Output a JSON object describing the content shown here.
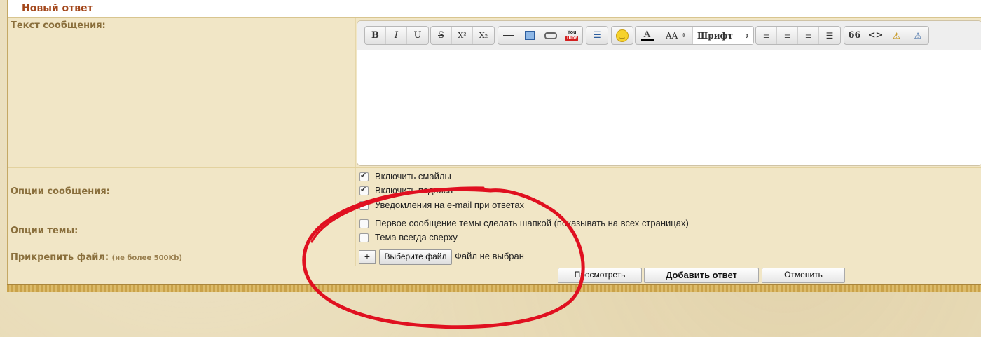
{
  "header": {
    "title": "Новый ответ"
  },
  "labels": {
    "message_text": "Текст сообщения:",
    "message_options": "Опции сообщения:",
    "topic_options": "Опции темы:",
    "attach_file": "Прикрепить файл:",
    "attach_limit": "(не более 500Kb)"
  },
  "toolbar": {
    "bold": "B",
    "italic": "I",
    "underline": "U",
    "strike": "S",
    "superscript": "X²",
    "subscript": "X₂",
    "youtube_top": "You",
    "youtube_bottom": "Tube",
    "font_color": "A",
    "font_size": "AA",
    "font_family": "Шрифт",
    "quote": "66",
    "code": "<>"
  },
  "message_options": [
    {
      "label": "Включить смайлы",
      "checked": true
    },
    {
      "label": "Включить подпись",
      "checked": true
    },
    {
      "label": "Уведомления на e-mail при ответах",
      "checked": false
    }
  ],
  "topic_options": [
    {
      "label": "Первое сообщение темы сделать шапкой (показывать на всех страницах)",
      "checked": false
    },
    {
      "label": "Тема всегда сверху",
      "checked": false
    }
  ],
  "file": {
    "add_label": "+",
    "choose_label": "Выберите файл",
    "status": "Файл не выбран"
  },
  "actions": {
    "preview": "Просмотреть",
    "submit": "Добавить ответ",
    "cancel": "Отменить"
  },
  "colors": {
    "title": "#a3461a",
    "label": "#8a6f3c",
    "annotation": "#e01020",
    "font_color_bar": "#000000"
  },
  "icons": [
    "hr-icon",
    "image-icon",
    "link-icon",
    "youtube-icon",
    "list-icon",
    "smiley-icon",
    "align-left-icon",
    "align-center-icon",
    "align-right-icon",
    "align-justify-icon",
    "spoiler-icon",
    "hide-icon"
  ]
}
